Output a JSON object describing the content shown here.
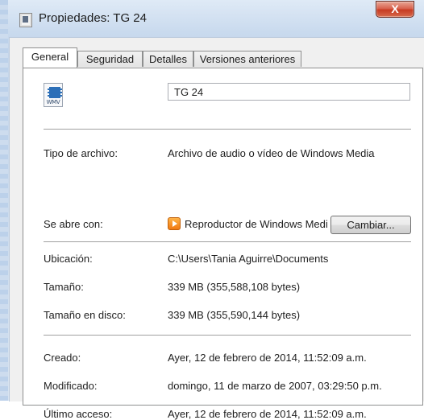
{
  "window": {
    "title": "Propiedades: TG 24",
    "close_label": "X"
  },
  "tabs": [
    {
      "label": "General",
      "active": true
    },
    {
      "label": "Seguridad",
      "active": false
    },
    {
      "label": "Detalles",
      "active": false
    },
    {
      "label": "Versiones anteriores",
      "active": false
    }
  ],
  "file": {
    "icon": "wmv-file-icon",
    "icon_ext": "WMV",
    "name": "TG 24"
  },
  "type": {
    "label": "Tipo de archivo:",
    "value": "Archivo de audio o vídeo de Windows Media"
  },
  "opens_with": {
    "label": "Se abre con:",
    "icon": "media-player-icon",
    "value": "Reproductor de Windows Media",
    "button": "Cambiar..."
  },
  "location": {
    "label": "Ubicación:",
    "value": "C:\\Users\\Tania Aguirre\\Documents"
  },
  "size": {
    "label": "Tamaño:",
    "value": "339 MB (355,588,108 bytes)"
  },
  "size_on_disk": {
    "label": "Tamaño en disco:",
    "value": "339 MB (355,590,144 bytes)"
  },
  "created": {
    "label": "Creado:",
    "value": "Ayer, 12 de febrero de 2014, 11:52:09 a.m."
  },
  "modified": {
    "label": "Modificado:",
    "value": "domingo, 11 de marzo de 2007, 03:29:50 p.m."
  },
  "accessed": {
    "label": "Último acceso:",
    "value": "Ayer, 12 de febrero de 2014, 11:52:09 a.m."
  },
  "colors": {
    "close_button": "#c63a22",
    "frame": "#c9daee",
    "panel": "#ffffff"
  }
}
